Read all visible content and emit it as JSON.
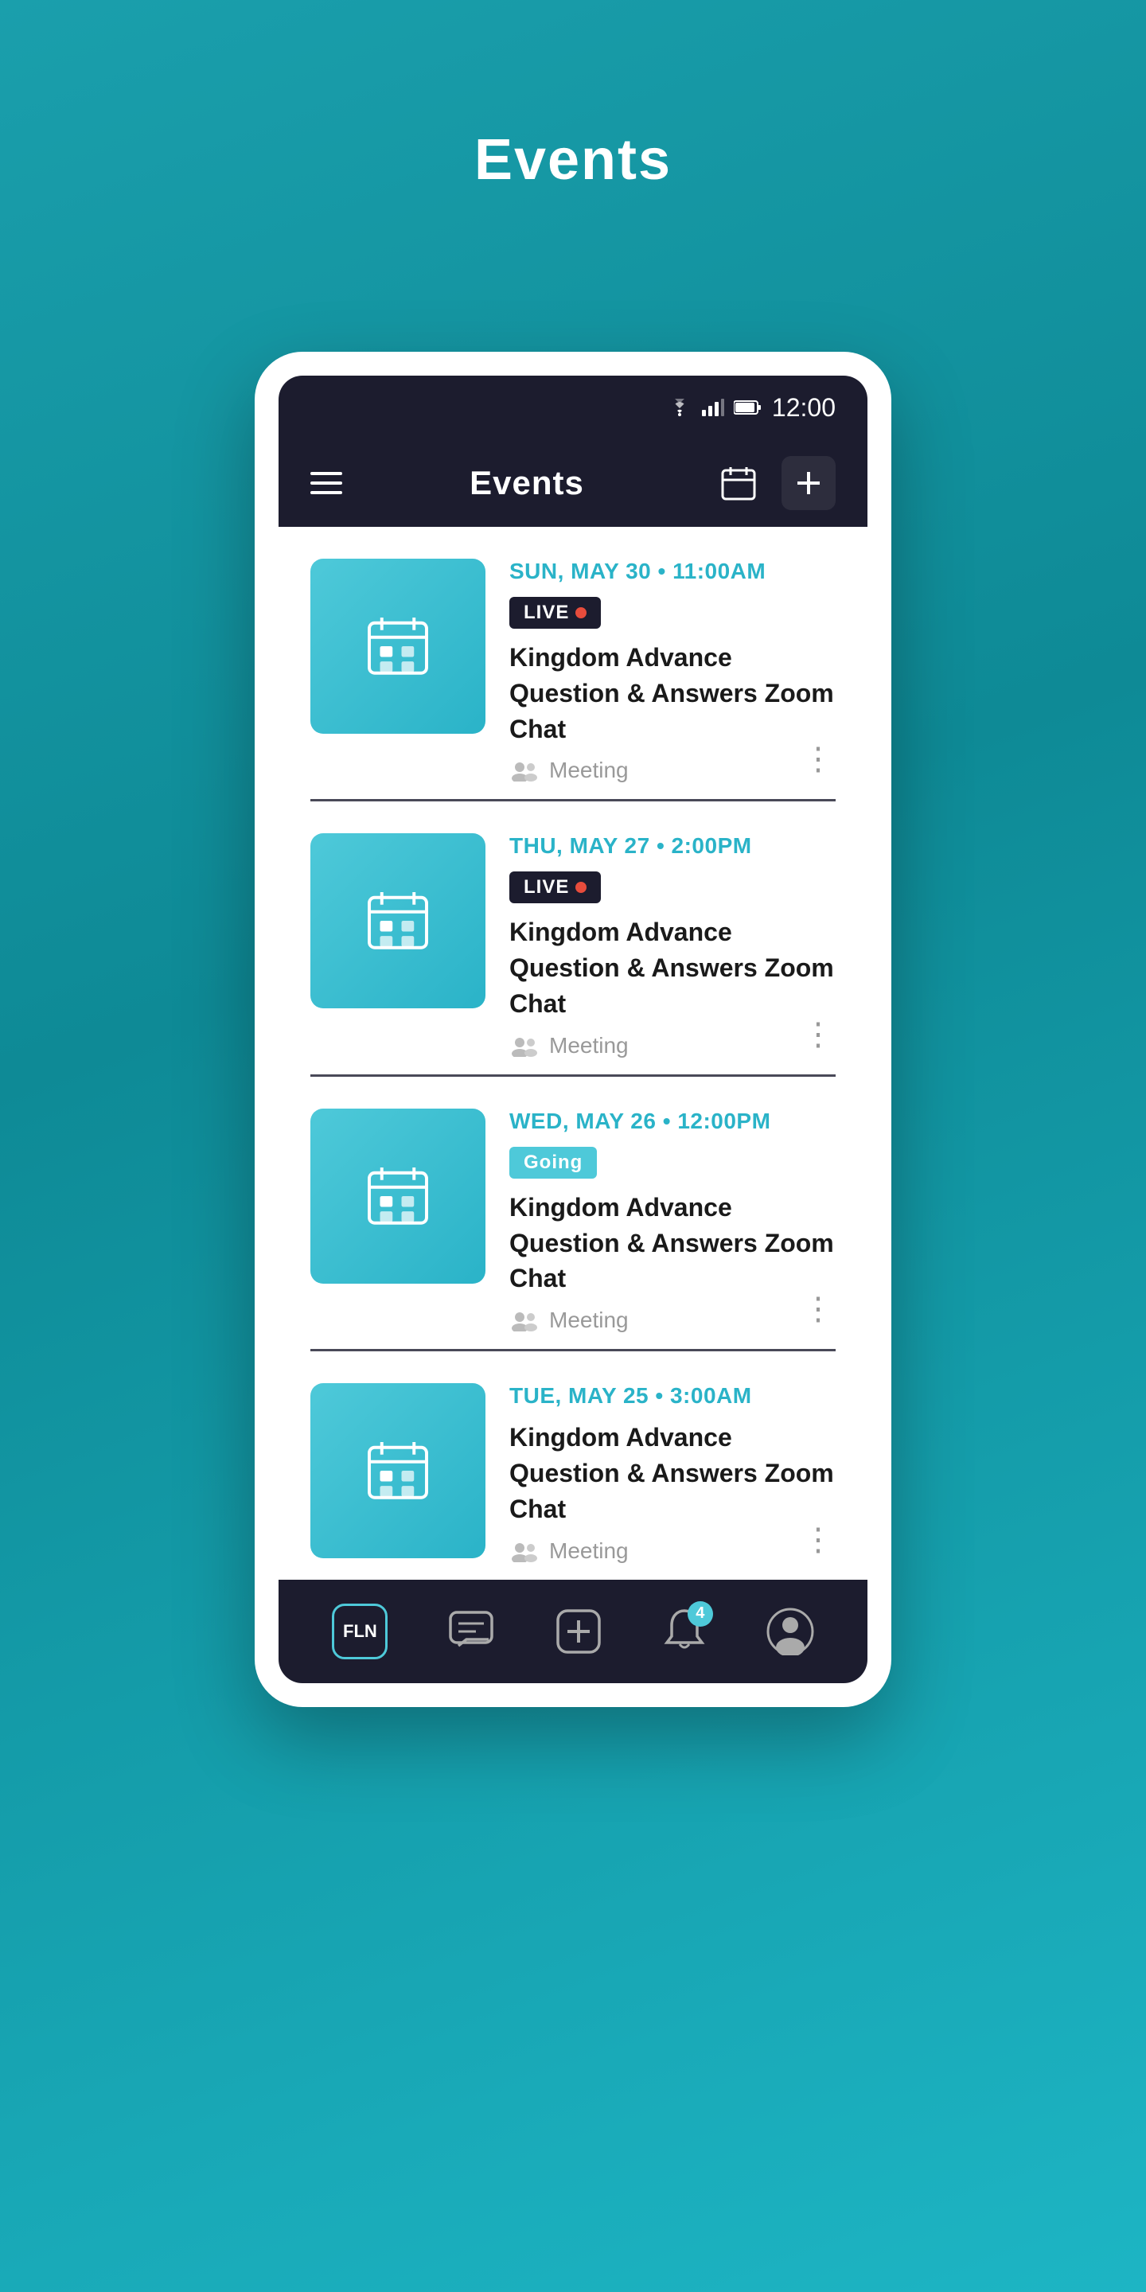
{
  "page": {
    "title": "Events",
    "background_color": "#0e8a96"
  },
  "status_bar": {
    "time": "12:00",
    "wifi": "▾",
    "signal": "▾",
    "battery": "▾"
  },
  "app_bar": {
    "title": "Events",
    "calendar_icon": "calendar",
    "add_icon": "plus"
  },
  "events": [
    {
      "id": 1,
      "date": "SUN, MAY 30 • 11:00AM",
      "badge_type": "live",
      "badge_label": "LIVE",
      "title": "Kingdom Advance Question & Answers Zoom Chat",
      "type": "Meeting"
    },
    {
      "id": 2,
      "date": "THU, MAY 27 • 2:00PM",
      "badge_type": "live",
      "badge_label": "LIVE",
      "title": "Kingdom Advance Question & Answers Zoom Chat",
      "type": "Meeting"
    },
    {
      "id": 3,
      "date": "WED, MAY 26 • 12:00PM",
      "badge_type": "going",
      "badge_label": "Going",
      "title": "Kingdom Advance Question & Answers Zoom Chat",
      "type": "Meeting"
    },
    {
      "id": 4,
      "date": "TUE, MAY 25 • 3:00AM",
      "badge_type": "none",
      "badge_label": "",
      "title": "Kingdom Advance Question & Answers Zoom Chat",
      "type": "Meeting"
    }
  ],
  "bottom_nav": {
    "items": [
      {
        "id": "home",
        "label": "FLN",
        "icon": "fln"
      },
      {
        "id": "chat",
        "label": "Chat",
        "icon": "chat"
      },
      {
        "id": "add",
        "label": "Add",
        "icon": "plus"
      },
      {
        "id": "notifications",
        "label": "Notifications",
        "icon": "bell",
        "badge": "4"
      },
      {
        "id": "profile",
        "label": "Profile",
        "icon": "avatar"
      }
    ]
  }
}
